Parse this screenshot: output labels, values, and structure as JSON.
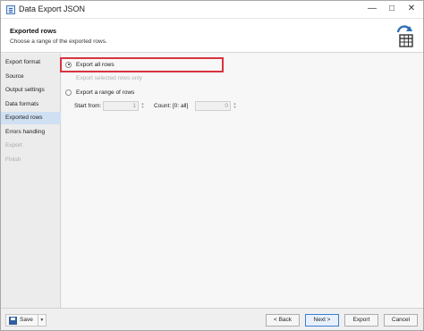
{
  "window": {
    "title": "Data Export JSON",
    "controls": [
      "—",
      "□",
      "✕"
    ]
  },
  "header": {
    "title": "Exported rows",
    "subtitle": "Choose a range of the exported rows.",
    "icon": "export-table-icon",
    "accent": "#2f6db5"
  },
  "sidebar": {
    "items": [
      {
        "label": "Export format",
        "state": "normal"
      },
      {
        "label": "Source",
        "state": "normal"
      },
      {
        "label": "Output settings",
        "state": "normal"
      },
      {
        "label": "Data formats",
        "state": "normal"
      },
      {
        "label": "Exported rows",
        "state": "active"
      },
      {
        "label": "Errors handling",
        "state": "normal"
      },
      {
        "label": "Export",
        "state": "disabled"
      },
      {
        "label": "Finish",
        "state": "disabled"
      }
    ]
  },
  "options": {
    "all_rows": {
      "label": "Export all rows",
      "selected": true
    },
    "selected_rows": {
      "label": "Export selected rows only",
      "enabled": false
    },
    "range": {
      "label": "Export a range of rows",
      "selected": false
    },
    "start_from": {
      "label": "Start from:",
      "value": "1"
    },
    "count": {
      "label": "Count: [0: all]",
      "value": "0"
    }
  },
  "footer": {
    "save_label": "Save",
    "back_label": "< Back",
    "next_label": "Next >",
    "export_label": "Export",
    "cancel_label": "Cancel"
  },
  "colors": {
    "highlight_border": "#d9333f",
    "active_nav": "#cfe0f3",
    "primary_button": "#3c7fd1"
  }
}
